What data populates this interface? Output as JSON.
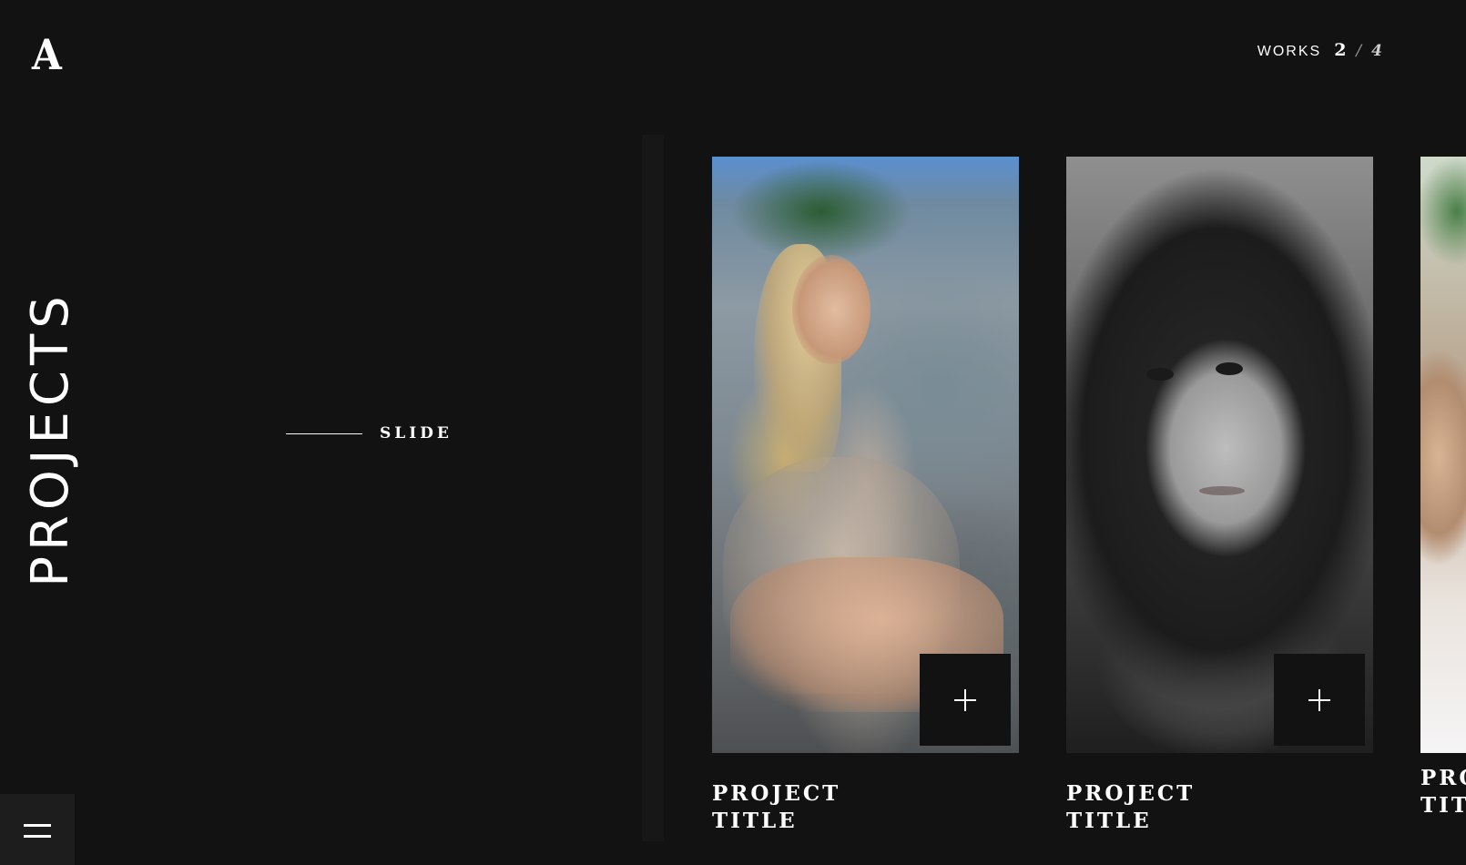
{
  "brand": {
    "logo_letter": "A"
  },
  "counter": {
    "label": "WORKS",
    "current": "2",
    "separator": "/",
    "total": "4"
  },
  "heading": {
    "title": "PROJECTS"
  },
  "slide_hint": {
    "label": "SLIDE"
  },
  "projects": [
    {
      "title_line1": "PROJECT",
      "title_line2": "TITLE",
      "image": "portrait-woman-on-rocks",
      "action_icon": "plus-icon"
    },
    {
      "title_line1": "PROJECT",
      "title_line2": "TITLE",
      "image": "portrait-woman-black-and-white",
      "action_icon": "plus-icon"
    },
    {
      "title_line1": "PROJECT",
      "title_line2": "TITLE",
      "image": "portrait-woman-partial"
    }
  ],
  "menu": {
    "icon": "hamburger-icon"
  },
  "colors": {
    "background": "#121213",
    "text": "#ffffff",
    "menu_background": "#1d1d1e",
    "divider": "#171718"
  }
}
